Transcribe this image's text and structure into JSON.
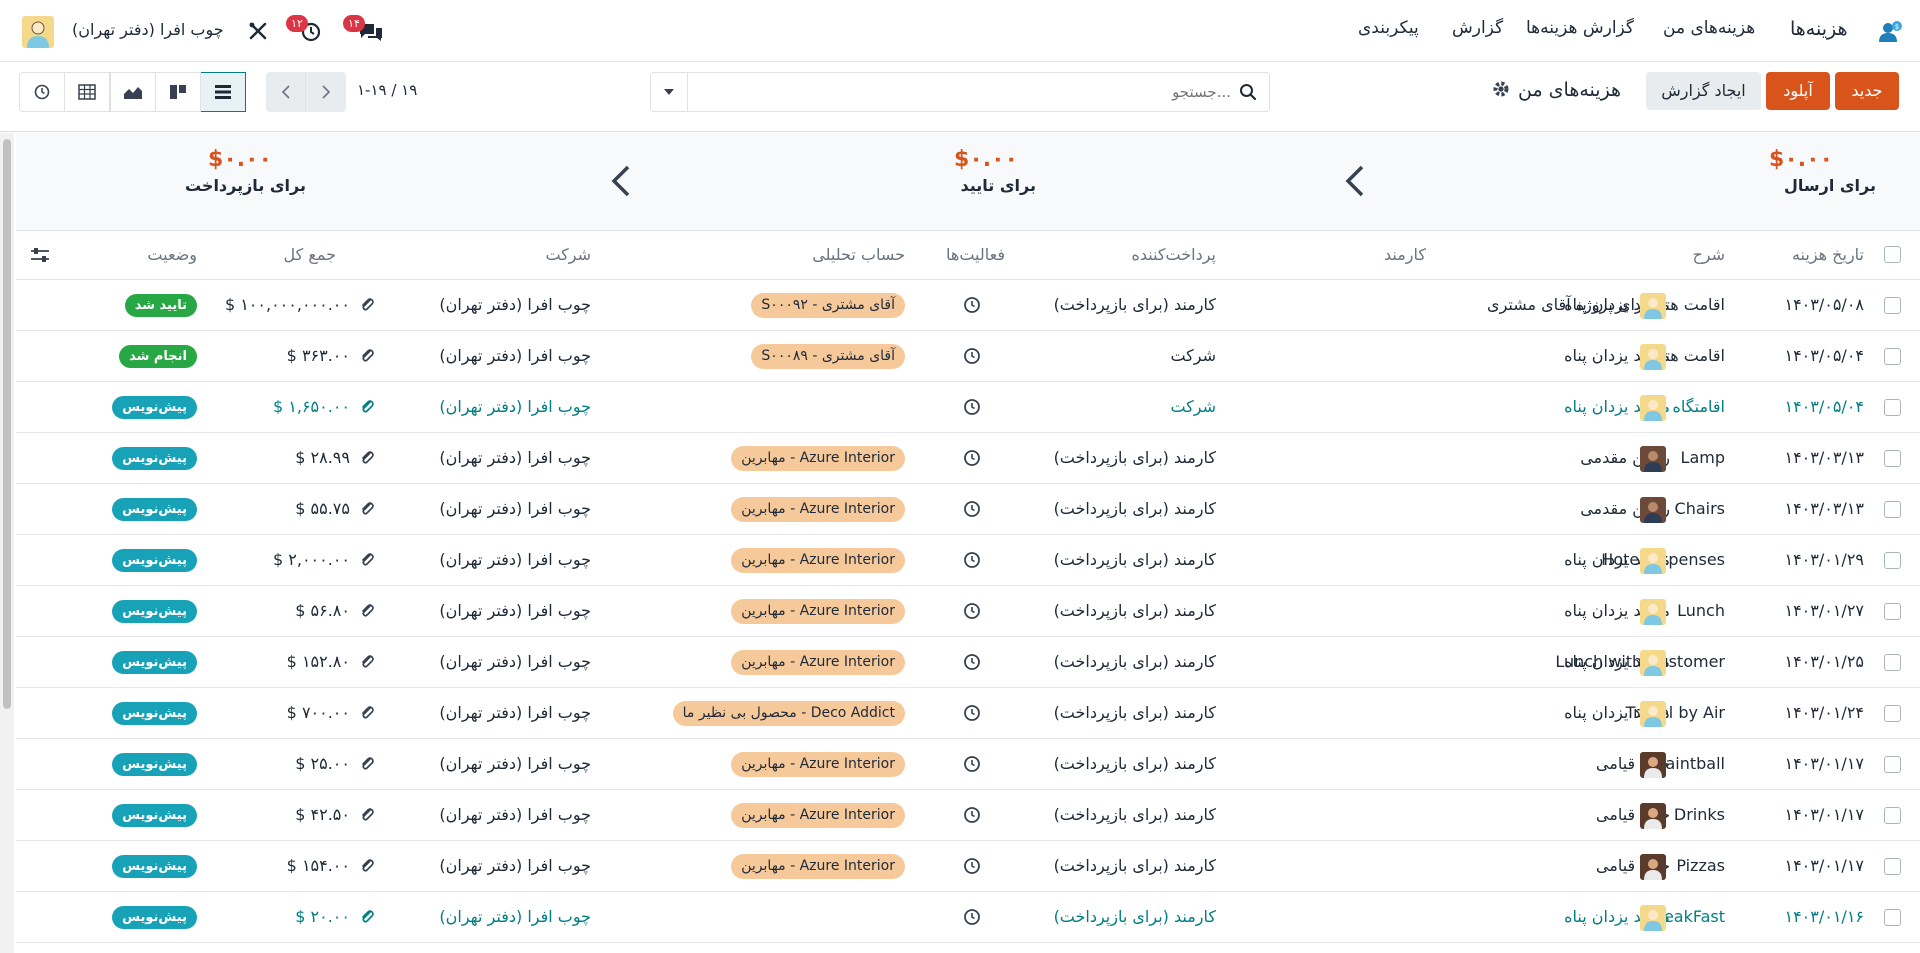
{
  "nav": {
    "app_name": "هزینه‌ها",
    "menu": [
      "هزینه‌های من",
      "گزارش هزینه‌ها",
      "گزارش",
      "پیکربندی"
    ],
    "company": "چوب افرا (دفتر تهران)",
    "activity_count": "۱۲",
    "message_count": "۱۴"
  },
  "controls": {
    "new_label": "جدید",
    "upload_label": "آپلود",
    "create_report_label": "ایجاد گزارش",
    "view_title": "هزینه‌های من",
    "search_placeholder": "جستجو...",
    "pager": "۱-۱۹ / ۱۹"
  },
  "summary": {
    "to_submit_amount": "$۰.۰۰",
    "to_submit_label": "برای ارسال",
    "to_approve_amount": "$۰.۰۰",
    "to_approve_label": "برای تایید",
    "to_reimburse_amount": "$۰.۰۰",
    "to_reimburse_label": "برای بازپرداخت"
  },
  "columns": {
    "date": "تاریخ هزینه",
    "description": "شرح",
    "employee": "کارمند",
    "paid_by": "پرداخت‌کننده",
    "activities": "فعالیت‌ها",
    "analytic": "حساب تحلیلی",
    "company": "شرکت",
    "total": "جمع کل",
    "status": "وضعیت"
  },
  "rows": [
    {
      "date": "۱۴۰۳/۰۵/۰۸",
      "description": "اقامت هتل برای پروژه آقای مشتری",
      "employee": "محمد یزدان پناه",
      "paid_by": "کارمند (برای بازپرداخت)",
      "analytic": "S۰۰۰۹۲ - آقای مشتری",
      "company": "چوب افرا (دفتر تهران)",
      "total": "$ ۱۰۰,۰۰۰,۰۰۰.۰۰",
      "status": "تایید شد"
    },
    {
      "date": "۱۴۰۳/۰۵/۰۴",
      "description": "اقامت هتل",
      "employee": "محمد یزدان پناه",
      "paid_by": "شرکت",
      "analytic": "S۰۰۰۸۹ - آقای مشتری",
      "company": "چوب افرا (دفتر تهران)",
      "total": "$ ۳۶۳.۰۰",
      "status": "انجام شد"
    },
    {
      "date": "۱۴۰۳/۰۵/۰۴",
      "description": "اقامتگاه هتل",
      "employee": "محمد یزدان پناه",
      "paid_by": "شرکت",
      "analytic": "",
      "company": "چوب افرا (دفتر تهران)",
      "total": "$ ۱,۶۵۰.۰۰",
      "status": "پیش‌نویس"
    },
    {
      "date": "۱۴۰۳/۰۳/۱۳",
      "description": "Lamp",
      "employee": "رامین مقدمی",
      "paid_by": "کارمند (برای بازپرداخت)",
      "analytic": "مهابرین - Azure Interior",
      "company": "چوب افرا (دفتر تهران)",
      "total": "$ ۲۸.۹۹",
      "status": "پیش‌نویس"
    },
    {
      "date": "۱۴۰۳/۰۳/۱۳",
      "description": "Chairs",
      "employee": "رامین مقدمی",
      "paid_by": "کارمند (برای بازپرداخت)",
      "analytic": "مهابرین - Azure Interior",
      "company": "چوب افرا (دفتر تهران)",
      "total": "$ ۵۵.۷۵",
      "status": "پیش‌نویس"
    },
    {
      "date": "۱۴۰۳/۰۱/۲۹",
      "description": "Hotel Expenses",
      "employee": "محمد یزدان پناه",
      "paid_by": "کارمند (برای بازپرداخت)",
      "analytic": "مهابرین - Azure Interior",
      "company": "چوب افرا (دفتر تهران)",
      "total": "$ ۲,۰۰۰.۰۰",
      "status": "پیش‌نویس"
    },
    {
      "date": "۱۴۰۳/۰۱/۲۷",
      "description": "Lunch",
      "employee": "محمد یزدان پناه",
      "paid_by": "کارمند (برای بازپرداخت)",
      "analytic": "مهابرین - Azure Interior",
      "company": "چوب افرا (دفتر تهران)",
      "total": "$ ۵۶.۸۰",
      "status": "پیش‌نویس"
    },
    {
      "date": "۱۴۰۳/۰۱/۲۵",
      "description": "Lunch with Customer",
      "employee": "محمد یزدان پناه",
      "paid_by": "کارمند (برای بازپرداخت)",
      "analytic": "مهابرین - Azure Interior",
      "company": "چوب افرا (دفتر تهران)",
      "total": "$ ۱۵۲.۸۰",
      "status": "پیش‌نویس"
    },
    {
      "date": "۱۴۰۳/۰۱/۲۴",
      "description": "Travel by Air",
      "employee": "محمد یزدان پناه",
      "paid_by": "کارمند (برای بازپرداخت)",
      "analytic": "محصول بی نظیر ما - Deco Addict",
      "company": "چوب افرا (دفتر تهران)",
      "total": "$ ۷۰۰.۰۰",
      "status": "پیش‌نویس"
    },
    {
      "date": "۱۴۰۳/۰۱/۱۷",
      "description": "Paintball",
      "employee": "جواد قیامی",
      "paid_by": "کارمند (برای بازپرداخت)",
      "analytic": "مهابرین - Azure Interior",
      "company": "چوب افرا (دفتر تهران)",
      "total": "$ ۲۵.۰۰",
      "status": "پیش‌نویس"
    },
    {
      "date": "۱۴۰۳/۰۱/۱۷",
      "description": "Drinks",
      "employee": "جواد قیامی",
      "paid_by": "کارمند (برای بازپرداخت)",
      "analytic": "مهابرین - Azure Interior",
      "company": "چوب افرا (دفتر تهران)",
      "total": "$ ۴۲.۵۰",
      "status": "پیش‌نویس"
    },
    {
      "date": "۱۴۰۳/۰۱/۱۷",
      "description": "Pizzas",
      "employee": "جواد قیامی",
      "paid_by": "کارمند (برای بازپرداخت)",
      "analytic": "مهابرین - Azure Interior",
      "company": "چوب افرا (دفتر تهران)",
      "total": "$ ۱۵۴.۰۰",
      "status": "پیش‌نویس"
    },
    {
      "date": "۱۴۰۳/۰۱/۱۶",
      "description": "BreakFast",
      "employee": "محمد یزدان پناه",
      "paid_by": "کارمند (برای بازپرداخت)",
      "analytic": "",
      "company": "چوب افرا (دفتر تهران)",
      "total": "$ ۲۰.۰۰",
      "status": "پیش‌نویس"
    }
  ],
  "colors": {
    "primary": "#d9541b",
    "teal": "#017e84",
    "approved": "#28a745",
    "draft_badge": "#17a2b8",
    "tag": "#f6c99a"
  }
}
